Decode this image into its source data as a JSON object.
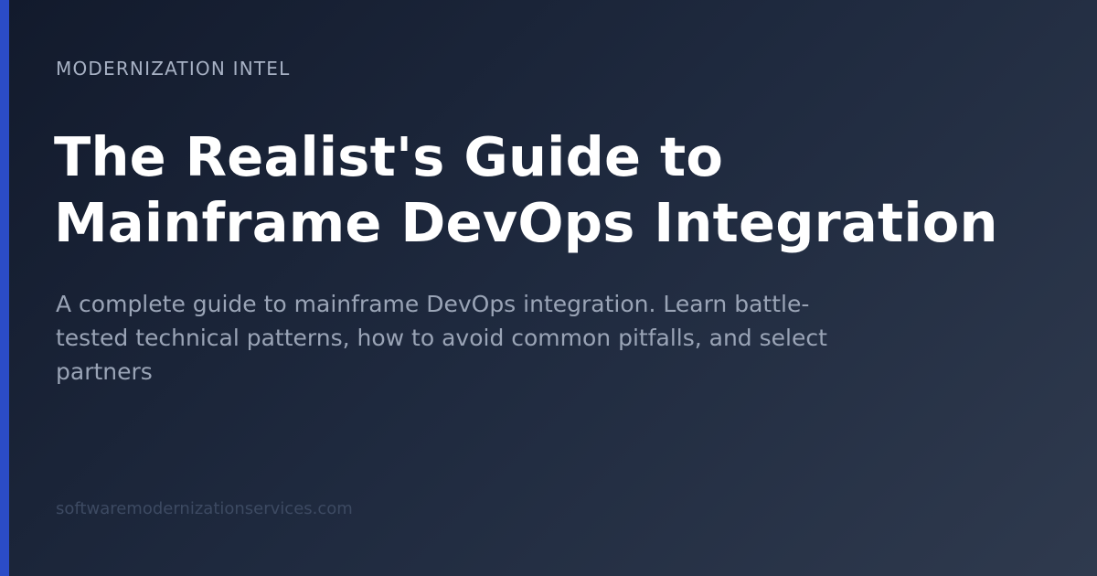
{
  "eyebrow": "MODERNIZATION INTEL",
  "title": {
    "line1": "The Realist's Guide to",
    "line2": "Mainframe DevOps Integration"
  },
  "description": {
    "line1": "A complete guide to mainframe DevOps integration. Learn battle-",
    "line2": "tested technical patterns, how to avoid common pitfalls, and select",
    "line3": "partners"
  },
  "domain": "softwaremodernizationservices.com",
  "colors": {
    "accent": "#2b4cc7",
    "background_start": "#121a2c",
    "background_end": "#2f3a4e",
    "title": "#ffffff",
    "description": "#9aa4b6",
    "eyebrow": "#a7b1c4",
    "domain": "#3d4a62"
  }
}
